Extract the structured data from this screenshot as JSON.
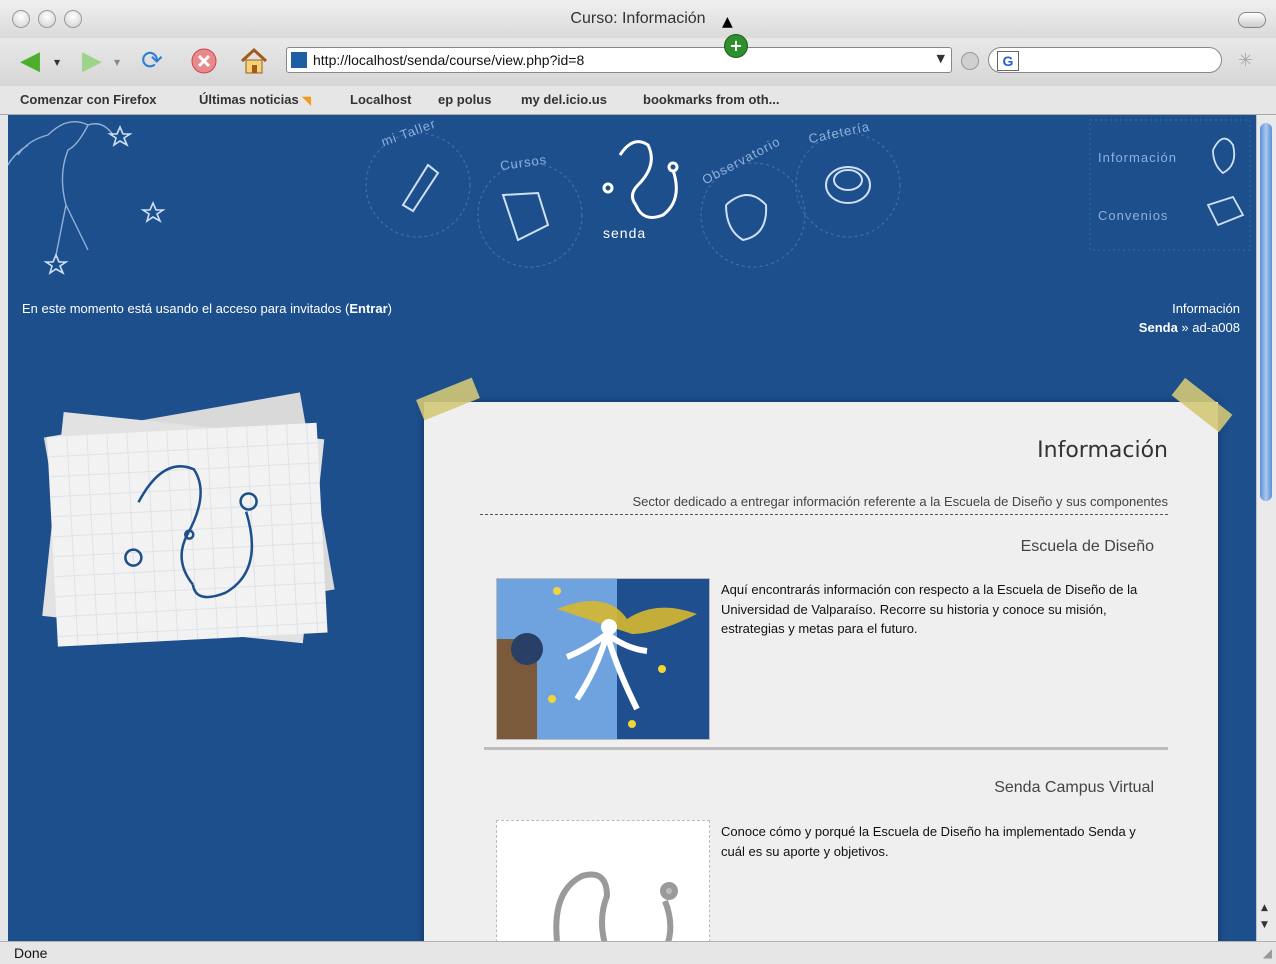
{
  "window": {
    "title": "Curso: Información"
  },
  "toolbar": {
    "url": "http://localhost/senda/course/view.php?id=8",
    "search_engine": "G"
  },
  "bookmarks": [
    "Comenzar con Firefox",
    "Últimas noticias",
    "Localhost",
    "ep polus",
    "my del.icio.us",
    "bookmarks from oth..."
  ],
  "site": {
    "nav": {
      "mi_taller": "mi Taller",
      "cursos": "Cursos",
      "observatorio": "Observatorio",
      "cafeteria": "Cafetería",
      "logo_text": "senda",
      "informacion": "Información",
      "convenios": "Convenios"
    },
    "guest": {
      "message": "En este momento está usando el acceso para invitados (",
      "login_link": "Entrar",
      "close": ")"
    },
    "breadcrumb": {
      "title": "Información",
      "root": "Senda",
      "separator": " » ",
      "current": "ad-a008"
    }
  },
  "panel": {
    "title": "Información",
    "subtitle": "Sector dedicado a entregar información referente a la Escuela de Diseño y sus componentes",
    "sections": [
      {
        "heading": "Escuela de Diseño",
        "text": "Aquí encontrarás información con respecto a la Escuela de Diseño de la Universidad de Valparaíso. Recorre su historia y conoce su misión, estrategias y metas para el futuro."
      },
      {
        "heading": "Senda Campus Virtual",
        "text": "Conoce cómo y porqué la Escuela de Diseño ha implementado Senda y cuál es su aporte y objetivos."
      }
    ]
  },
  "status": {
    "text": "Done"
  },
  "colors": {
    "page_bg": "#1d4f8d",
    "paper": "#efefef",
    "tape": "#d4c878"
  }
}
